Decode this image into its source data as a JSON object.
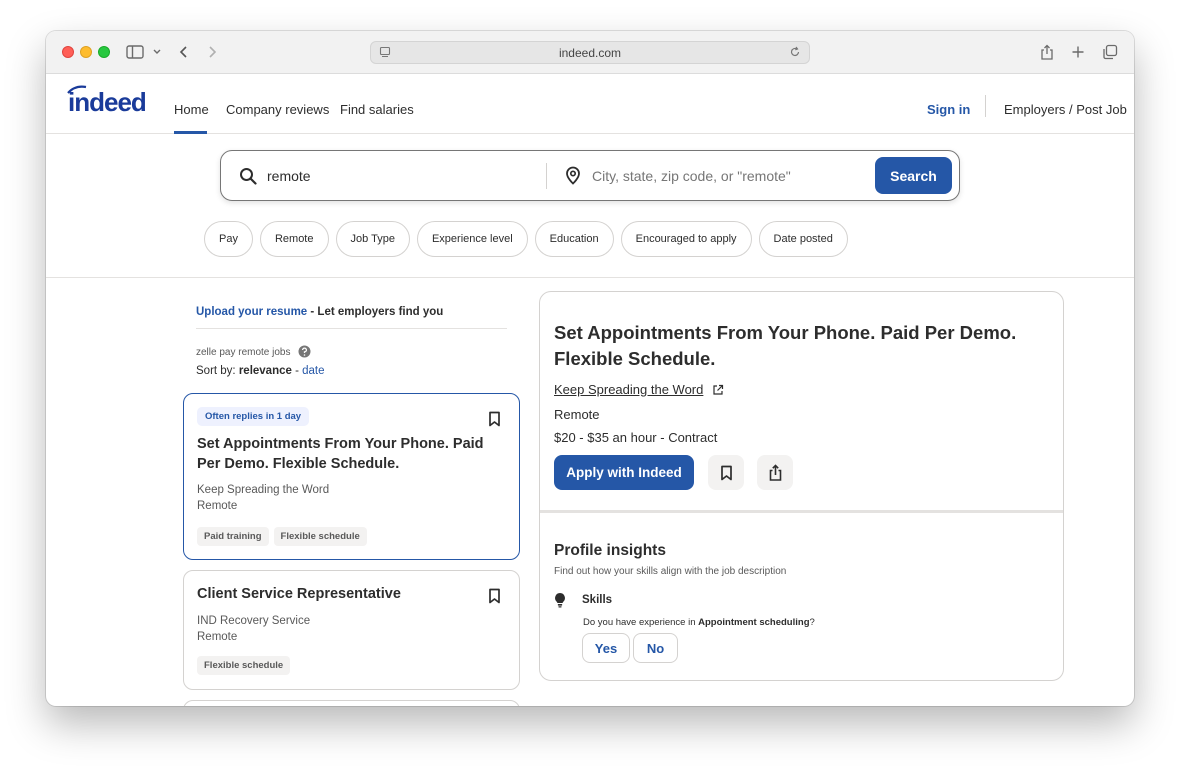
{
  "browser": {
    "url": "indeed.com"
  },
  "header": {
    "logo": "indeed",
    "nav": [
      {
        "label": "Home"
      },
      {
        "label": "Company reviews"
      },
      {
        "label": "Find salaries"
      }
    ],
    "sign_in": "Sign in",
    "employers": "Employers / Post Job"
  },
  "search": {
    "what_value": "remote",
    "where_placeholder": "City, state, zip code, or \"remote\"",
    "button": "Search"
  },
  "filters": [
    "Pay",
    "Remote",
    "Job Type",
    "Experience level",
    "Education",
    "Encouraged to apply",
    "Date posted"
  ],
  "results": {
    "upload_link": "Upload your resume",
    "upload_rest": " - Let employers find you",
    "query_label": "zelle pay remote jobs",
    "sort_prefix": "Sort by: ",
    "sort_active": "relevance",
    "sort_sep": " - ",
    "sort_alt": "date",
    "jobs": [
      {
        "badge": "Often replies in 1 day",
        "title": "Set Appointments From Your Phone. Paid Per Demo. Flexible Schedule.",
        "company": "Keep Spreading the Word",
        "location": "Remote",
        "tags": [
          "Paid training",
          "Flexible schedule"
        ]
      },
      {
        "title": "Client Service Representative",
        "company": "IND Recovery Service",
        "location": "Remote",
        "tags": [
          "Flexible schedule"
        ]
      }
    ]
  },
  "detail": {
    "title": "Set Appointments From Your Phone. Paid Per Demo. Flexible Schedule.",
    "company": "Keep Spreading the Word",
    "location": "Remote",
    "pay": "$20 - $35 an hour  - Contract",
    "apply": "Apply with Indeed",
    "insights_title": "Profile insights",
    "insights_sub": "Find out how your skills align with the job description",
    "skills_label": "Skills",
    "question_prefix": "Do you have experience in ",
    "question_skill": "Appointment scheduling",
    "question_suffix": "?",
    "yes": "Yes",
    "no": "No"
  },
  "colors": {
    "brand_blue": "#2557a7",
    "logo_blue": "#1a3b9a"
  }
}
